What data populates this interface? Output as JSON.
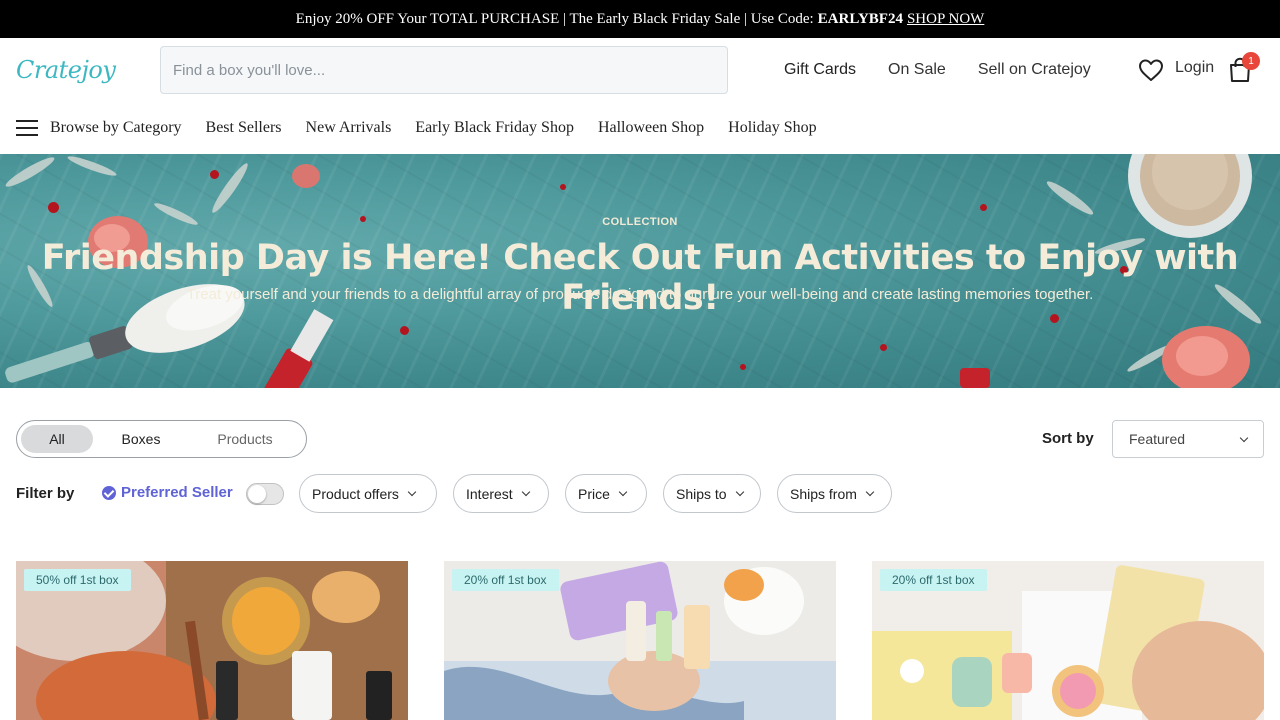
{
  "promo": {
    "text": "Enjoy 20% OFF Your TOTAL PURCHASE | The Early Black Friday Sale | Use Code:",
    "code": "EARLYBF24",
    "link": "SHOP NOW"
  },
  "header": {
    "logo": "Cratejoy",
    "search_placeholder": "Find a box you'll love...",
    "links": [
      "Gift Cards",
      "On Sale",
      "Sell on Cratejoy"
    ],
    "login": "Login",
    "cart_count": "1"
  },
  "nav": {
    "items": [
      "Browse by Category",
      "Best Sellers",
      "New Arrivals",
      "Early Black Friday Shop",
      "Halloween Shop",
      "Holiday Shop"
    ]
  },
  "hero": {
    "kicker": "COLLECTION",
    "title": "Friendship Day is Here! Check Out Fun Activities to Enjoy with Friends!",
    "subtitle": "Treat yourself and your friends to a delightful array of products designed to nurture your well-being and create lasting memories together."
  },
  "filters": {
    "segments": [
      "All",
      "Boxes",
      "Products"
    ],
    "sort_label": "Sort by",
    "sort_value": "Featured",
    "filter_label": "Filter by",
    "preferred_seller": "Preferred Seller",
    "pills": [
      "Product offers",
      "Interest",
      "Price",
      "Ships to",
      "Ships from"
    ]
  },
  "products": [
    {
      "tag": "50% off 1st box"
    },
    {
      "tag": "20% off 1st box"
    },
    {
      "tag": "20% off 1st box"
    }
  ],
  "colors": {
    "brand": "#3cb8c2",
    "hero_bg": "#4f9a9d",
    "accent": "#5f63d6",
    "badge": "#e8463b"
  }
}
